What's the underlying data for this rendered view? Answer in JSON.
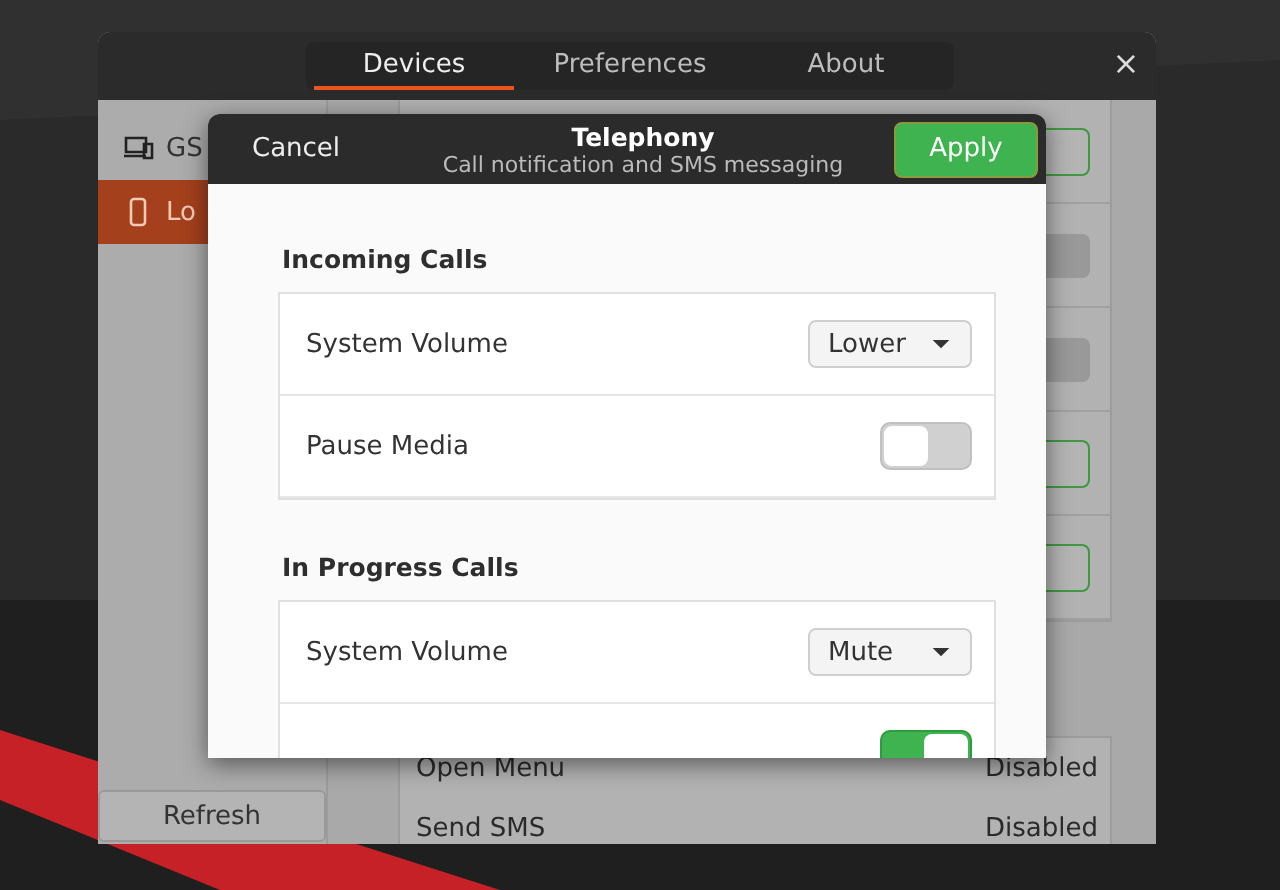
{
  "window": {
    "tabs": [
      {
        "label": "Devices",
        "selected": true
      },
      {
        "label": "Preferences",
        "selected": false
      },
      {
        "label": "About",
        "selected": false
      }
    ],
    "close": "×"
  },
  "sidebar": {
    "items": [
      {
        "kind": "desktop",
        "label": "GS",
        "selected": false
      },
      {
        "kind": "phone",
        "label": "Lo",
        "selected": true
      }
    ],
    "refresh": "Refresh"
  },
  "content": {
    "rows": [
      {
        "kind": "button"
      },
      {
        "kind": "toggle",
        "on": false
      },
      {
        "kind": "toggle",
        "on": false
      },
      {
        "kind": "button"
      },
      {
        "kind": "button"
      }
    ],
    "shortcuts": [
      {
        "label": "Open Menu",
        "value": "Disabled"
      },
      {
        "label": "Send SMS",
        "value": "Disabled"
      }
    ]
  },
  "dialog": {
    "cancel": "Cancel",
    "title": "Telephony",
    "subtitle": "Call notification and SMS messaging",
    "apply": "Apply",
    "sections": [
      {
        "title": "Incoming Calls",
        "rows": [
          {
            "kind": "dropdown",
            "label": "System Volume",
            "value": "Lower"
          },
          {
            "kind": "switch",
            "label": "Pause Media",
            "on": false
          }
        ]
      },
      {
        "title": "In Progress Calls",
        "rows": [
          {
            "kind": "dropdown",
            "label": "System Volume",
            "value": "Mute"
          },
          {
            "kind": "switch",
            "on": true
          }
        ]
      }
    ]
  }
}
